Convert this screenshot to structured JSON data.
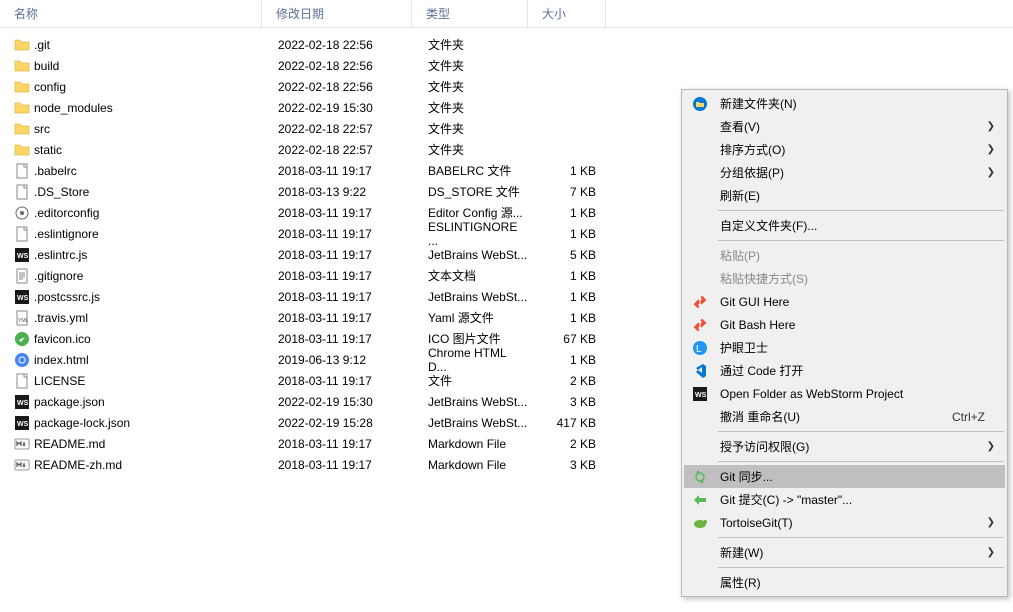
{
  "columns": {
    "name": "名称",
    "date": "修改日期",
    "type": "类型",
    "size": "大小"
  },
  "files": [
    {
      "name": ".git",
      "date": "2022-02-18 22:56",
      "type": "文件夹",
      "size": "",
      "icon": "folder"
    },
    {
      "name": "build",
      "date": "2022-02-18 22:56",
      "type": "文件夹",
      "size": "",
      "icon": "folder"
    },
    {
      "name": "config",
      "date": "2022-02-18 22:56",
      "type": "文件夹",
      "size": "",
      "icon": "folder"
    },
    {
      "name": "node_modules",
      "date": "2022-02-19 15:30",
      "type": "文件夹",
      "size": "",
      "icon": "folder"
    },
    {
      "name": "src",
      "date": "2022-02-18 22:57",
      "type": "文件夹",
      "size": "",
      "icon": "folder"
    },
    {
      "name": "static",
      "date": "2022-02-18 22:57",
      "type": "文件夹",
      "size": "",
      "icon": "folder"
    },
    {
      "name": ".babelrc",
      "date": "2018-03-11 19:17",
      "type": "BABELRC 文件",
      "size": "1 KB",
      "icon": "file"
    },
    {
      "name": ".DS_Store",
      "date": "2018-03-13 9:22",
      "type": "DS_STORE 文件",
      "size": "7 KB",
      "icon": "file"
    },
    {
      "name": ".editorconfig",
      "date": "2018-03-11 19:17",
      "type": "Editor Config 源...",
      "size": "1 KB",
      "icon": "editorconfig"
    },
    {
      "name": ".eslintignore",
      "date": "2018-03-11 19:17",
      "type": "ESLINTIGNORE ...",
      "size": "1 KB",
      "icon": "file"
    },
    {
      "name": ".eslintrc.js",
      "date": "2018-03-11 19:17",
      "type": "JetBrains WebSt...",
      "size": "5 KB",
      "icon": "ws"
    },
    {
      "name": ".gitignore",
      "date": "2018-03-11 19:17",
      "type": "文本文档",
      "size": "1 KB",
      "icon": "text"
    },
    {
      "name": ".postcssrc.js",
      "date": "2018-03-11 19:17",
      "type": "JetBrains WebSt...",
      "size": "1 KB",
      "icon": "ws"
    },
    {
      "name": ".travis.yml",
      "date": "2018-03-11 19:17",
      "type": "Yaml 源文件",
      "size": "1 KB",
      "icon": "yaml"
    },
    {
      "name": "favicon.ico",
      "date": "2018-03-11 19:17",
      "type": "ICO 图片文件",
      "size": "67 KB",
      "icon": "ico"
    },
    {
      "name": "index.html",
      "date": "2019-06-13 9:12",
      "type": "Chrome HTML D...",
      "size": "1 KB",
      "icon": "chrome"
    },
    {
      "name": "LICENSE",
      "date": "2018-03-11 19:17",
      "type": "文件",
      "size": "2 KB",
      "icon": "file"
    },
    {
      "name": "package.json",
      "date": "2022-02-19 15:30",
      "type": "JetBrains WebSt...",
      "size": "3 KB",
      "icon": "ws"
    },
    {
      "name": "package-lock.json",
      "date": "2022-02-19 15:28",
      "type": "JetBrains WebSt...",
      "size": "417 KB",
      "icon": "ws"
    },
    {
      "name": "README.md",
      "date": "2018-03-11 19:17",
      "type": "Markdown File",
      "size": "2 KB",
      "icon": "md"
    },
    {
      "name": "README-zh.md",
      "date": "2018-03-11 19:17",
      "type": "Markdown File",
      "size": "3 KB",
      "icon": "md"
    }
  ],
  "menu": {
    "items": [
      {
        "label": "新建文件夹(N)",
        "icon": "newfolder",
        "arrow": false
      },
      {
        "label": "查看(V)",
        "icon": "",
        "arrow": true
      },
      {
        "label": "排序方式(O)",
        "icon": "",
        "arrow": true
      },
      {
        "label": "分组依据(P)",
        "icon": "",
        "arrow": true
      },
      {
        "label": "刷新(E)",
        "icon": "",
        "arrow": false
      },
      {
        "sep": true
      },
      {
        "label": "自定义文件夹(F)...",
        "icon": "",
        "arrow": false
      },
      {
        "sep": true
      },
      {
        "label": "粘贴(P)",
        "icon": "",
        "arrow": false,
        "disabled": true
      },
      {
        "label": "粘贴快捷方式(S)",
        "icon": "",
        "arrow": false,
        "disabled": true
      },
      {
        "label": "Git GUI Here",
        "icon": "git",
        "arrow": false
      },
      {
        "label": "Git Bash Here",
        "icon": "git",
        "arrow": false
      },
      {
        "label": "护眼卫士",
        "icon": "eye",
        "arrow": false
      },
      {
        "label": "通过 Code 打开",
        "icon": "vscode",
        "arrow": false
      },
      {
        "label": "Open Folder as WebStorm Project",
        "icon": "ws",
        "arrow": false
      },
      {
        "label": "撤消 重命名(U)",
        "icon": "",
        "arrow": false,
        "shortcut": "Ctrl+Z"
      },
      {
        "sep": true
      },
      {
        "label": "授予访问权限(G)",
        "icon": "",
        "arrow": true
      },
      {
        "sep": true
      },
      {
        "label": "Git 同步...",
        "icon": "gitsync",
        "arrow": false,
        "selected": true
      },
      {
        "label": "Git 提交(C) -> \"master\"...",
        "icon": "gitcommit",
        "arrow": false
      },
      {
        "label": "TortoiseGit(T)",
        "icon": "tortoise",
        "arrow": true
      },
      {
        "sep": true
      },
      {
        "label": "新建(W)",
        "icon": "",
        "arrow": true
      },
      {
        "sep": true
      },
      {
        "label": "属性(R)",
        "icon": "",
        "arrow": false
      }
    ]
  }
}
